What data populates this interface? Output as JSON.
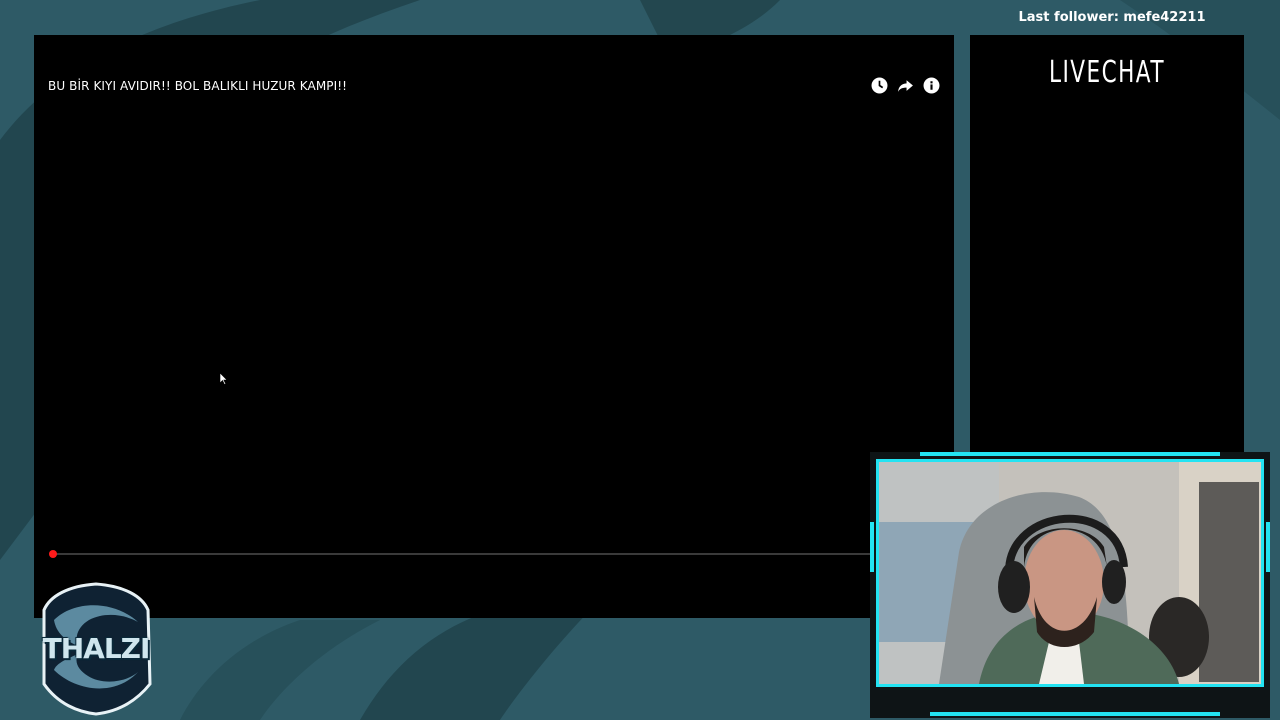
{
  "overlay": {
    "last_follower": "Last follower: mefe42211"
  },
  "video": {
    "title": "BU BİR KIYI AVIDIR!! BOL BALIKLI HUZUR KAMPI!!",
    "controls": {
      "watch_later_icon": "clock-icon",
      "share_icon": "share-arrow-icon",
      "info_icon": "info-icon"
    },
    "progress_fraction": 0.004
  },
  "chat": {
    "title": "LIVECHAT"
  },
  "logo": {
    "text": "THALZI"
  },
  "colors": {
    "background": "#2e5a66",
    "accent_cyan": "#23e3f2",
    "progress_red": "#ff0000"
  }
}
